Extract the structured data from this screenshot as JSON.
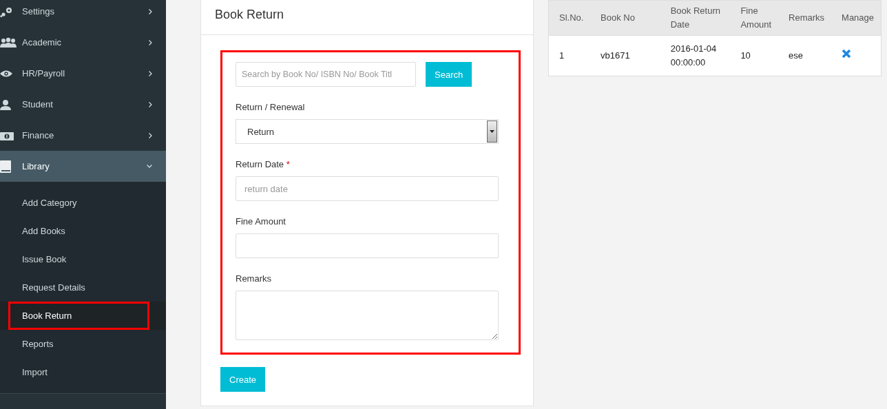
{
  "sidebar": {
    "items": [
      {
        "label": "Settings",
        "expanded": false,
        "selected": false
      },
      {
        "label": "Academic",
        "expanded": false,
        "selected": false
      },
      {
        "label": "HR/Payroll",
        "expanded": false,
        "selected": false
      },
      {
        "label": "Student",
        "expanded": false,
        "selected": false
      },
      {
        "label": "Finance",
        "expanded": false,
        "selected": false
      },
      {
        "label": "Library",
        "expanded": true,
        "selected": true,
        "children": [
          {
            "label": "Add Category",
            "selected": false,
            "highlighted": false
          },
          {
            "label": "Add Books",
            "selected": false,
            "highlighted": false
          },
          {
            "label": "Issue Book",
            "selected": false,
            "highlighted": false
          },
          {
            "label": "Request Details",
            "selected": false,
            "highlighted": false
          },
          {
            "label": "Book Return",
            "selected": true,
            "highlighted": true
          },
          {
            "label": "Reports",
            "selected": false,
            "highlighted": false
          },
          {
            "label": "Import",
            "selected": false,
            "highlighted": false
          }
        ]
      }
    ]
  },
  "card": {
    "title": "Book Return",
    "form": {
      "highlighted": true,
      "search": {
        "placeholder": "Search by Book No/ ISBN No/ Book Titl",
        "button": "Search"
      },
      "fields": [
        {
          "kind": "select",
          "label": "Return / Renewal",
          "value": "Return"
        },
        {
          "kind": "input",
          "label": "Return Date",
          "required_mark": "*",
          "placeholder": "return date"
        },
        {
          "kind": "input",
          "label": "Fine Amount"
        },
        {
          "kind": "textarea",
          "label": "Remarks"
        }
      ]
    },
    "submit": "Create"
  },
  "table": {
    "columns": [
      "Sl.No.",
      "Book No",
      "Book Return Date",
      "Fine Amount",
      "Remarks",
      "Manage"
    ],
    "rows": [
      {
        "cells": [
          "1",
          "vb1671",
          "2016-01-04 00:00:00",
          "10",
          "ese"
        ]
      }
    ]
  }
}
